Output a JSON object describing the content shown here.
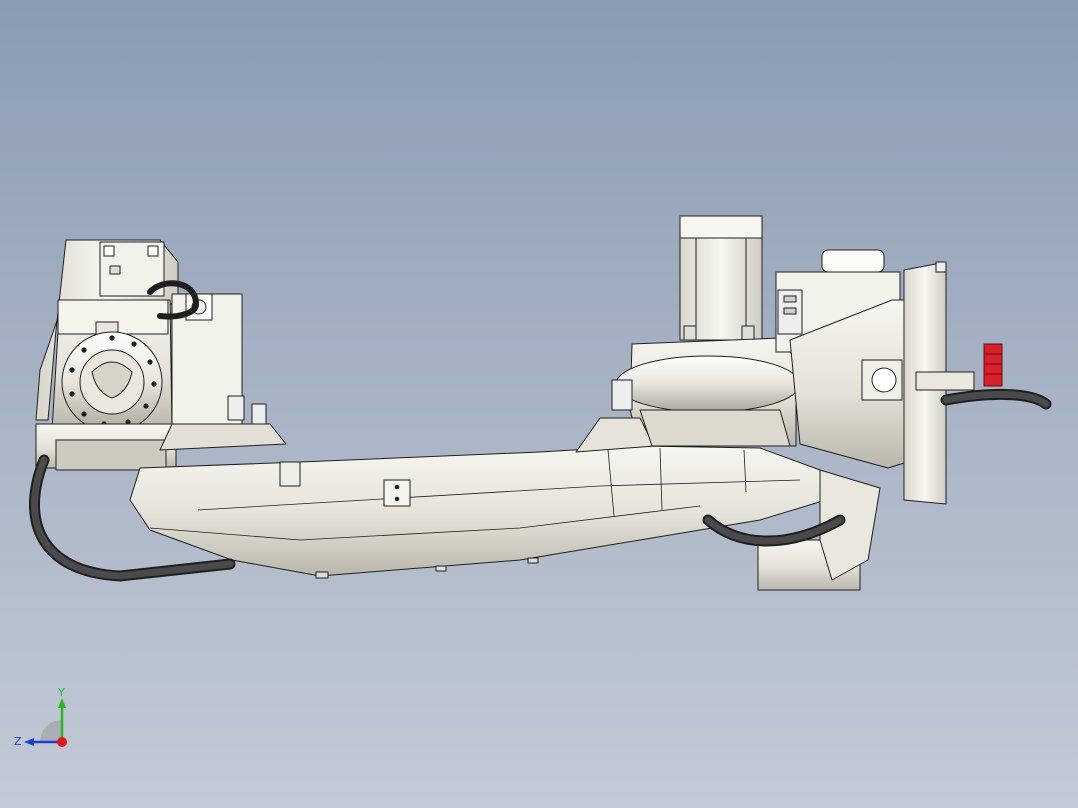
{
  "triad": {
    "y_label": "Y",
    "z_label": "Z",
    "colors": {
      "y_axis": "#22b822",
      "z_axis": "#1a3fd6",
      "x_axis": "#e01818"
    }
  },
  "viewport": {
    "background_top": "#8a9bb2",
    "background_bottom": "#c3cad5"
  },
  "model": {
    "icon": "robot-arm-assembly",
    "colors": {
      "body": "#ecebe3",
      "shade": "#cfcdc2",
      "edge": "#1f1f1f",
      "cable": "#2b2b2b",
      "handle": "#d8202a"
    }
  }
}
